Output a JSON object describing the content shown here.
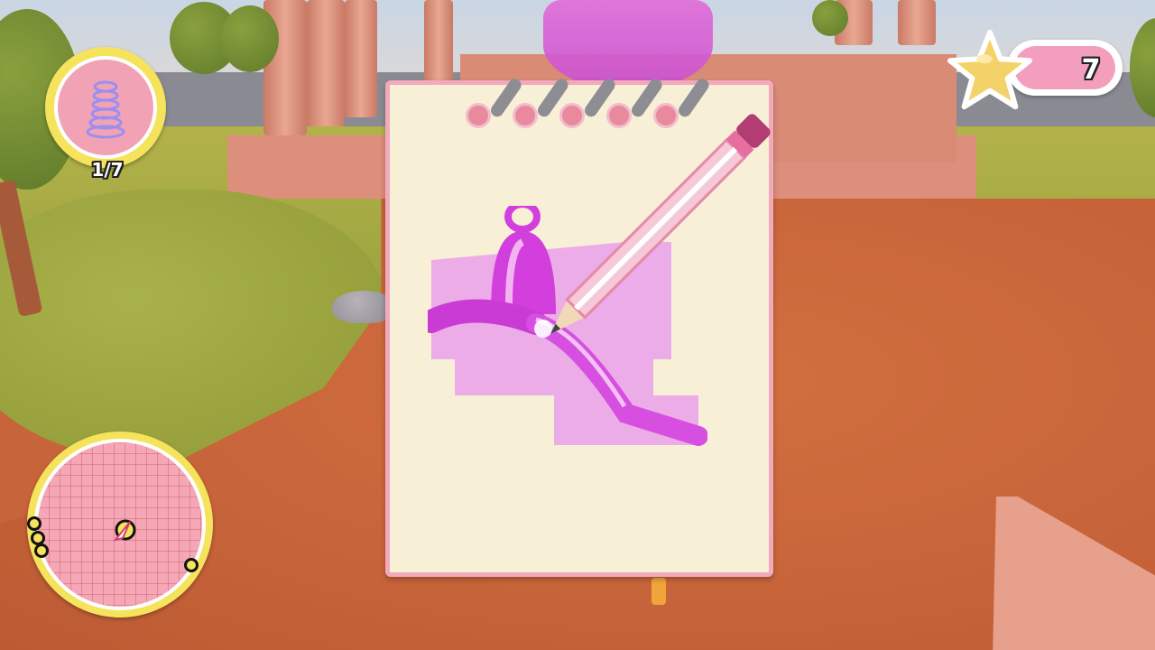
{
  "hud": {
    "quest": {
      "icon": "spring-icon",
      "progress_text": "1/7",
      "progress_value": 1,
      "progress_total": 7
    },
    "stars": {
      "icon": "star-icon",
      "count": "7"
    },
    "minimap": {
      "player_icon": "player-arrow-icon",
      "marker_count": 4
    }
  },
  "notepad": {
    "drawing_subject": "bell-vacuum-icon",
    "tool_icon": "pencil-icon",
    "ring_count": 5
  },
  "colors": {
    "hud_yellow": "#f6e35c",
    "hud_pink": "#f49ebd",
    "drawing_magenta": "#d23fdc",
    "paper": "#f8f0d6",
    "ground": "#c8643a"
  }
}
